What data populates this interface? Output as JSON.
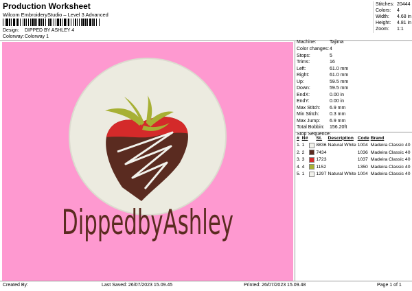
{
  "header": {
    "title": "Production Worksheet",
    "subtitle": "Wilcom EmbroideryStudio – Level 3 Advanced",
    "design_label": "Design:",
    "design_value": "DIPPED BY ASHLEY 4",
    "colorway_label": "Colorway:",
    "colorway_value": "Colorway 1"
  },
  "stats": [
    {
      "label": "Stitches:",
      "value": "20444"
    },
    {
      "label": "Colors:",
      "value": "4"
    },
    {
      "label": "Width:",
      "value": "4.68 in"
    },
    {
      "label": "Height:",
      "value": "4.81 in"
    },
    {
      "label": "Zoom:",
      "value": "1:1"
    }
  ],
  "machine_info": [
    {
      "label": "Machine:",
      "value": "Tajima"
    },
    {
      "label": "Color changes:",
      "value": "4"
    },
    {
      "label": "Stops:",
      "value": "5"
    },
    {
      "label": "Trims:",
      "value": "16"
    },
    {
      "label": "Left:",
      "value": "61.0 mm"
    },
    {
      "label": "Right:",
      "value": "61.0 mm"
    },
    {
      "label": "Up:",
      "value": "59.5 mm"
    },
    {
      "label": "Down:",
      "value": "59.5 mm"
    },
    {
      "label": "EndX:",
      "value": "0.00 in"
    },
    {
      "label": "EndY:",
      "value": "0.00 in"
    },
    {
      "label": "Max Stitch:",
      "value": "6.9 mm"
    },
    {
      "label": "Min Stitch:",
      "value": "0.3 mm"
    },
    {
      "label": "Max Jump:",
      "value": "6.9 mm"
    },
    {
      "label": "Total Bobbin:",
      "value": "156.20ft"
    }
  ],
  "stop_sequence": {
    "heading": "Stop Sequence:",
    "columns": [
      "#",
      "N#",
      "St.",
      "Description",
      "Code",
      "Brand"
    ],
    "rows": [
      {
        "num": "1.",
        "n": "1",
        "color": "#f2f2ec",
        "st": "8836",
        "desc": "Natural White",
        "code": "1004",
        "brand": "Madeira Classic 40"
      },
      {
        "num": "2.",
        "n": "2",
        "color": "#5a2b20",
        "st": "7434",
        "desc": "",
        "code": "1036",
        "brand": "Madeira Classic 40"
      },
      {
        "num": "3.",
        "n": "3",
        "color": "#d42a2a",
        "st": "1723",
        "desc": "",
        "code": "1037",
        "brand": "Madeira Classic 40"
      },
      {
        "num": "4.",
        "n": "4",
        "color": "#a7b034",
        "st": "1152",
        "desc": "",
        "code": "1350",
        "brand": "Madeira Classic 40"
      },
      {
        "num": "5.",
        "n": "1",
        "color": "#f2f2ec",
        "st": "1297",
        "desc": "Natural White",
        "code": "1004",
        "brand": "Madeira Classic 40"
      }
    ]
  },
  "design_text": "DippedbyAshley",
  "colors": {
    "background": "#fe99d0",
    "circle": "#ecebe0",
    "chocolate": "#5a2b20",
    "strawberry": "#d42a2a",
    "leaves": "#a7b034",
    "lettering": "#5a2b20"
  },
  "footer": {
    "created_by": "Created By:",
    "last_saved": "Last Saved: 26/07/2023 15.09.45",
    "printed": "Printed: 26/07/2023 15.09.48",
    "page": "Page 1 of 1"
  }
}
